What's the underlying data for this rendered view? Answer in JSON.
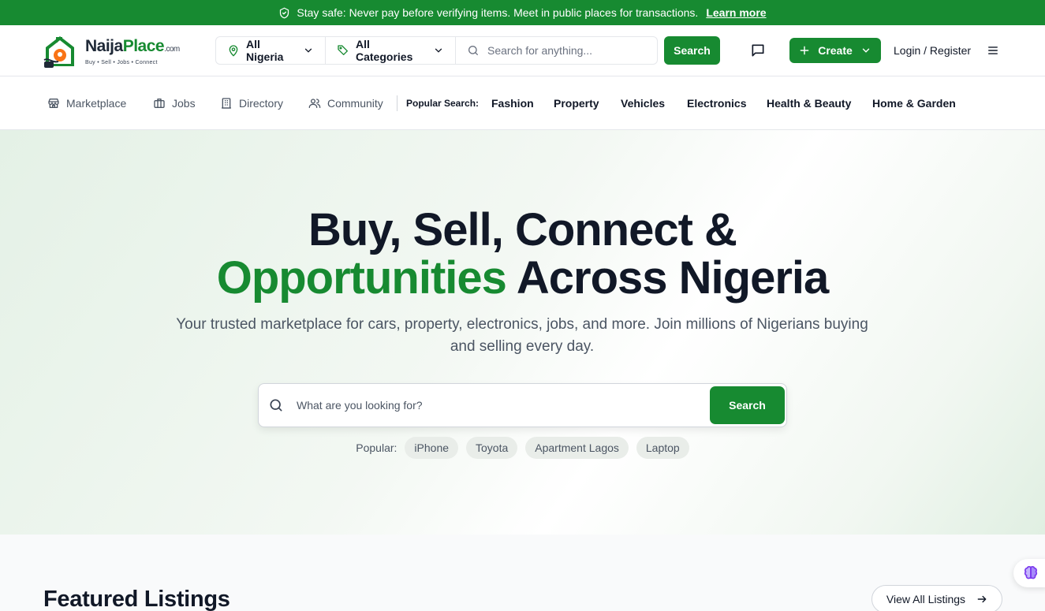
{
  "banner": {
    "text": "Stay safe: Never pay before verifying items. Meet in public places for transactions.",
    "link": "Learn more"
  },
  "logo": {
    "brand_dark": "Naija",
    "brand_green": "Place",
    "suffix": ".com",
    "tagline": "Buy • Sell • Jobs • Connect"
  },
  "header": {
    "location": "All Nigeria",
    "category": "All Categories",
    "search_placeholder": "Search for anything...",
    "search_button": "Search",
    "create_button": "Create",
    "login": "Login / Register"
  },
  "nav": {
    "items": [
      {
        "label": "Marketplace",
        "icon": "store-icon"
      },
      {
        "label": "Jobs",
        "icon": "briefcase-icon"
      },
      {
        "label": "Directory",
        "icon": "building-icon"
      },
      {
        "label": "Community",
        "icon": "users-icon"
      }
    ],
    "popular_label": "Popular Search:",
    "popular": [
      "Fashion",
      "Property",
      "Vehicles",
      "Electronics",
      "Health & Beauty",
      "Home & Garden"
    ]
  },
  "hero": {
    "title_line1": "Buy, Sell, Connect &",
    "title_green": "Opportunities",
    "title_rest": "Across Nigeria",
    "subtitle": "Your trusted marketplace for cars, property, electronics, jobs, and more. Join millions of Nigerians buying and selling every day.",
    "search_placeholder": "What are you looking for?",
    "search_button": "Search",
    "popular_label": "Popular:",
    "popular_chips": [
      "iPhone",
      "Toyota",
      "Apartment Lagos",
      "Laptop"
    ]
  },
  "featured": {
    "title": "Featured Listings",
    "view_all": "View All Listings"
  },
  "colors": {
    "brand_green": "#178a31",
    "text_dark": "#111827",
    "text_muted": "#4b5563"
  }
}
